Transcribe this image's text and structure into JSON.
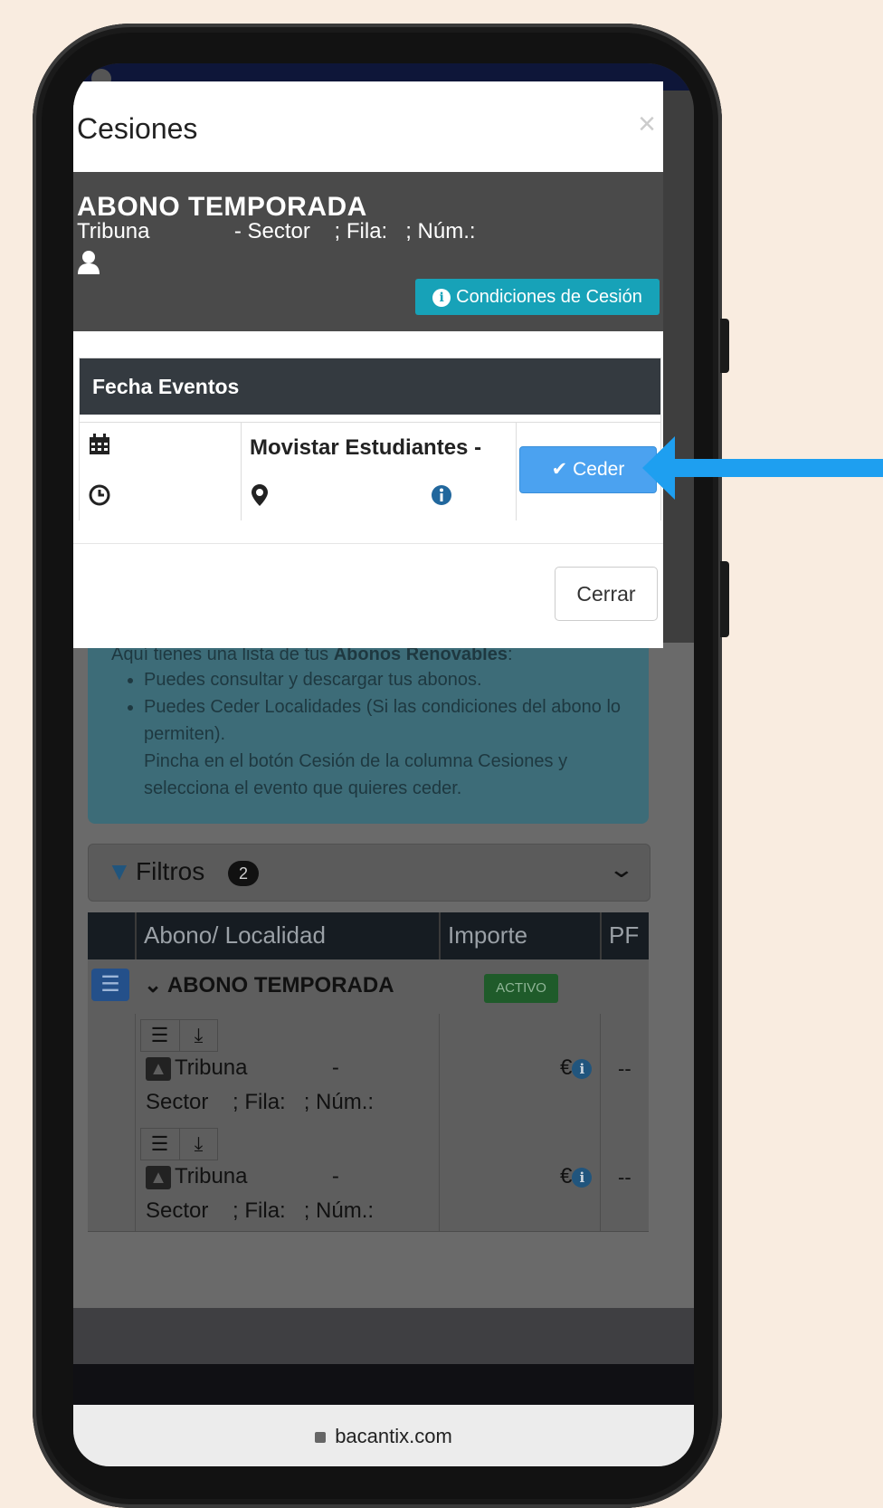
{
  "modal": {
    "title": "Cesiones",
    "close_glyph": "×",
    "abono_title": "ABONO TEMPORADA",
    "seat_info": "Tribuna              - Sector    ; Fila:   ; Núm.:",
    "conditions_button": "Condiciones de Cesión",
    "events_header": "Fecha Eventos",
    "event_name": "Movistar Estudiantes -",
    "ceder_button": "Ceder",
    "cerrar_button": "Cerrar"
  },
  "background_page": {
    "info_intro_pre": "Aquí tienes una lista de tus ",
    "info_intro_bold": "Abonos Renovables",
    "info_intro_post": ":",
    "bullets": [
      "Puedes consultar y descargar tus abonos.",
      "Puedes Ceder Localidades (Si las condiciones del abono lo permiten)."
    ],
    "bullet_continuation": "Pincha en el botón Cesión de la columna Cesiones y selecciona el evento que quieres ceder.",
    "filters_label": "Filtros",
    "filters_count": "2",
    "table_headers": [
      "Abono/ Localidad",
      "Importe",
      "PF"
    ],
    "group_title": "ABONO TEMPORADA",
    "group_status": "ACTIVO",
    "rows": [
      {
        "line1": "Tribuna              -",
        "line2": "Sector    ; Fila:   ; Núm.:",
        "importe": "€",
        "pf": "--"
      },
      {
        "line1": "Tribuna              -",
        "line2": "Sector    ; Fila:   ; Núm.:",
        "importe": "€",
        "pf": "--"
      }
    ]
  },
  "browser": {
    "url": "bacantix.com"
  },
  "colors": {
    "background": "#f9ece0",
    "conditions_button": "#17a2b8",
    "ceder_button": "#4ba2f0",
    "arrow": "#1e9ff0"
  }
}
